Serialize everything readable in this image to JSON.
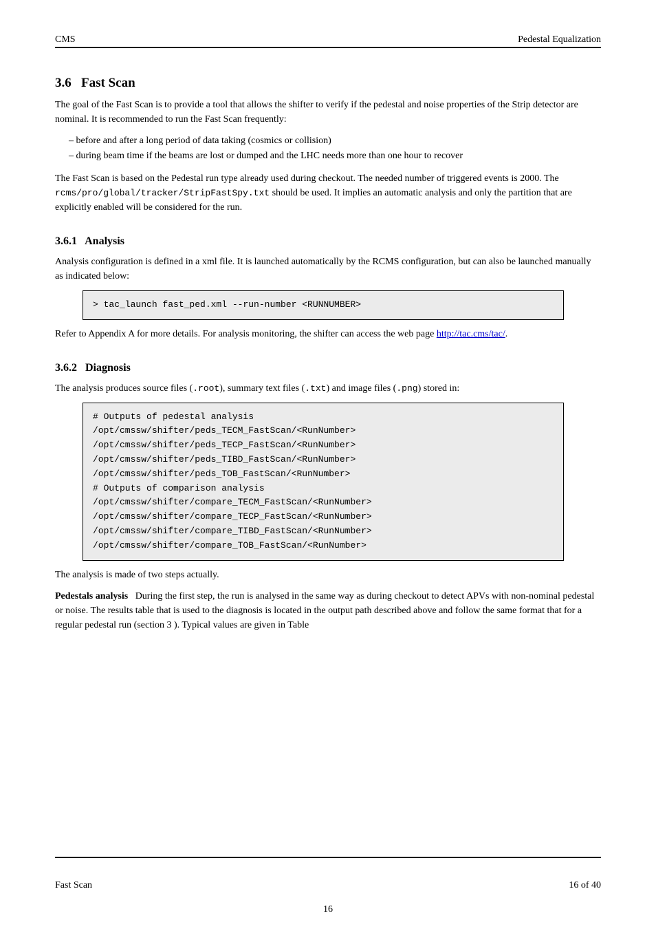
{
  "header": {
    "left": "CMS",
    "right": "Pedestal Equalization"
  },
  "section": {
    "number": "3.6",
    "title": "Fast Scan"
  },
  "intro": {
    "p1": "The goal of the Fast Scan is to provide a tool that allows the shifter to verify if the pedestal and noise properties of the Strip detector are nominal. It is recommended to run the Fast Scan frequently:",
    "bullets": [
      "before and after a long period of data taking (cosmics or collision)",
      "during beam time if the beams are lost or dumped and the LHC needs more than one hour to recover"
    ],
    "p2_before_code": "The Fast Scan is based on the Pedestal run type already used during checkout. The needed number of triggered events is 2000. The ",
    "p2_code": "rcms/pro/global/tracker/StripFastSpy.txt",
    "p2_after_code": " should be used. It implies an automatic analysis and only the partition that are explicitly enabled will be considered for the run."
  },
  "sub1": {
    "number": "3.6.1",
    "title": "Analysis",
    "text_before_box": "Analysis configuration is defined in a xml file. It is launched automatically by the RCMS configuration, but can also be launched manually as indicated below:",
    "code": "> tac_launch fast_ped.xml --run-number <RUNNUMBER>",
    "text_after_box": "Refer to Appendix ",
    "text_after_box_link": "A",
    "text_after_box_more": " for more details. For analysis monitoring, the shifter can access the web page "
  },
  "link": {
    "url": "http://tac.cms/tac/"
  },
  "sub2": {
    "number": "3.6.2",
    "title": "Diagnosis",
    "p1_before_code": "The analysis produces source files (",
    "p1_code1": ".root",
    "p1_mid": "), summary text files (",
    "p1_code2": ".txt",
    "p1_mid2": ") and image files (",
    "p1_code3": ".png",
    "p1_after": ") stored in:",
    "code": "# Outputs of pedestal analysis\n/opt/cmssw/shifter/peds_TECM_FastScan/<RunNumber>\n/opt/cmssw/shifter/peds_TECP_FastScan/<RunNumber>\n/opt/cmssw/shifter/peds_TIBD_FastScan/<RunNumber>\n/opt/cmssw/shifter/peds_TOB_FastScan/<RunNumber>\n# Outputs of comparison analysis\n/opt/cmssw/shifter/compare_TECM_FastScan/<RunNumber>\n/opt/cmssw/shifter/compare_TECP_FastScan/<RunNumber>\n/opt/cmssw/shifter/compare_TIBD_FastScan/<RunNumber>\n/opt/cmssw/shifter/compare_TOB_FastScan/<RunNumber>",
    "p2": "The analysis is made of two steps actually."
  },
  "pedestals": {
    "label": "Pedestals analysis",
    "text_before": "During the first step, the run is analysed in the same way as during checkout to detect APVs with non-nominal pedestal or noise. The results table that is used to the diagnosis is located in the output path described above and follow the same format that for a regular pedestal run (section ",
    "ref": "3",
    "text_after": "). Typical values are given in Table "
  },
  "footer": {
    "label": "Fast Scan",
    "pagecount": "16 of 40"
  },
  "pagenum": "16"
}
